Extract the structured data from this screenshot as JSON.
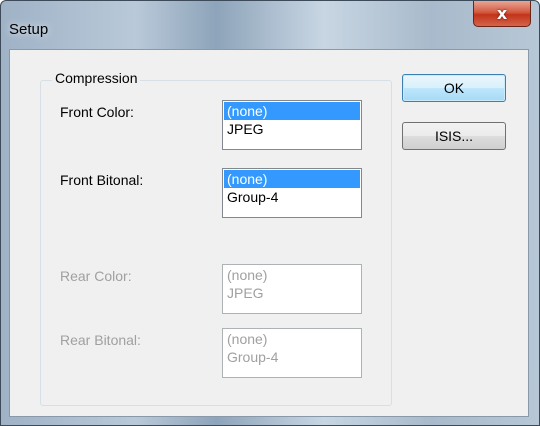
{
  "window": {
    "title": "Setup",
    "close_glyph": "x"
  },
  "compression": {
    "group_label": "Compression",
    "front_color": {
      "label": "Front Color:",
      "options": [
        "(none)",
        "JPEG"
      ],
      "selected": "(none)"
    },
    "front_bitonal": {
      "label": "Front Bitonal:",
      "options": [
        "(none)",
        "Group-4"
      ],
      "selected": "(none)"
    },
    "rear_color": {
      "label": "Rear Color:",
      "options": [
        "(none)",
        "JPEG"
      ],
      "enabled": false
    },
    "rear_bitonal": {
      "label": "Rear Bitonal:",
      "options": [
        "(none)",
        "Group-4"
      ],
      "enabled": false
    }
  },
  "buttons": {
    "ok": "OK",
    "isis": "ISIS..."
  },
  "colors": {
    "selection": "#3399ff",
    "disabled_text": "#a0a0a0",
    "default_button": "#bee6fd",
    "close_button": "#c2341a"
  }
}
